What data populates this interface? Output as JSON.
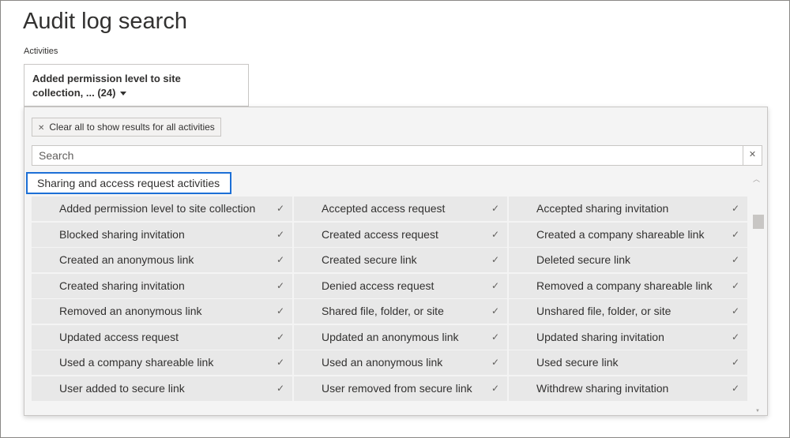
{
  "page": {
    "title": "Audit log search"
  },
  "activities": {
    "label": "Activities",
    "dropdown_line1": "Added permission level to site",
    "dropdown_line2": "collection, ... (24)"
  },
  "panel": {
    "clear_chip_label": "Clear all to show results for all activities",
    "clear_chip_icon": "close-icon",
    "search_placeholder": "Search",
    "search_value": "",
    "search_clear_icon": "close-icon",
    "category": "Sharing and access request activities",
    "check_glyph": "✓",
    "rows": [
      [
        "Added permission level to site collection",
        "Accepted access request",
        "Accepted sharing invitation"
      ],
      [
        "Blocked sharing invitation",
        "Created access request",
        "Created a company shareable link"
      ],
      [
        "Created an anonymous link",
        "Created secure link",
        "Deleted secure link"
      ],
      [
        "Created sharing invitation",
        "Denied access request",
        "Removed a company shareable link"
      ],
      [
        "Removed an anonymous link",
        "Shared file, folder, or site",
        "Unshared file, folder, or site"
      ],
      [
        "Updated access request",
        "Updated an anonymous link",
        "Updated sharing invitation"
      ],
      [
        "Used a company shareable link",
        "Used an anonymous link",
        "Used secure link"
      ],
      [
        "User added to secure link",
        "User removed from secure link",
        "Withdrew sharing invitation"
      ]
    ]
  },
  "colors": {
    "focus_border": "#1c6fd6",
    "cell_background": "#e8e8e8",
    "panel_background": "#f4f4f4"
  }
}
